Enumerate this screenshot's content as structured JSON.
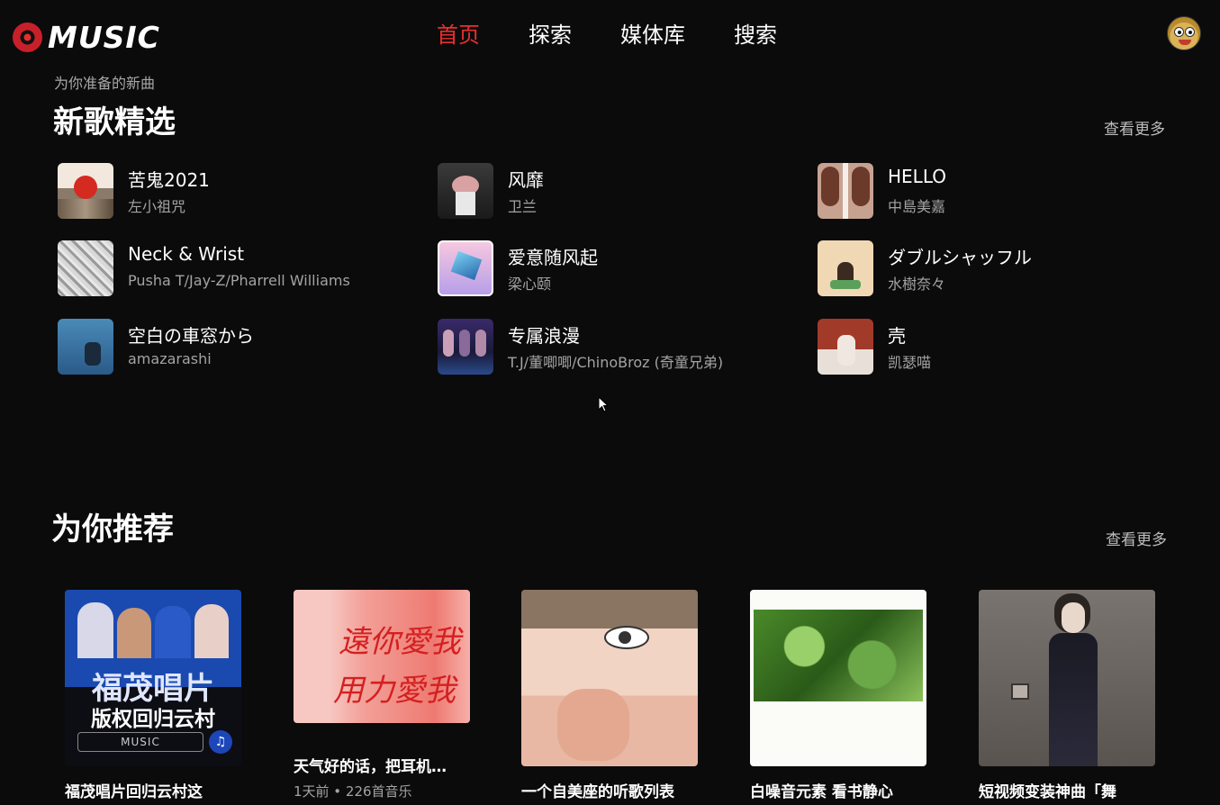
{
  "app": {
    "logo_text": "MUSIC"
  },
  "nav": {
    "items": [
      {
        "label": "首页",
        "active": true
      },
      {
        "label": "探索",
        "active": false
      },
      {
        "label": "媒体库",
        "active": false
      },
      {
        "label": "搜索",
        "active": false
      }
    ]
  },
  "new_songs": {
    "subtitle": "为你准备的新曲",
    "title": "新歌精选",
    "see_more": "查看更多",
    "items": [
      {
        "title": "苦鬼2021",
        "artist": "左小祖咒"
      },
      {
        "title": "风靡",
        "artist": "卫兰"
      },
      {
        "title": "HELLO",
        "artist": "中島美嘉"
      },
      {
        "title": "Neck & Wrist",
        "artist": "Pusha T/Jay-Z/Pharrell Williams"
      },
      {
        "title": "爱意随风起",
        "artist": "梁心颐"
      },
      {
        "title": "ダブルシャッフル",
        "artist": "水樹奈々"
      },
      {
        "title": "空白の車窓から",
        "artist": "amazarashi"
      },
      {
        "title": "专属浪漫",
        "artist": "T.J/董唧唧/ChinoBroz (奇童兄弟)"
      },
      {
        "title": "壳",
        "artist": "凯瑟喵"
      }
    ]
  },
  "recommend": {
    "title": "为你推荐",
    "see_more": "查看更多",
    "cover1_text": {
      "line1": "福茂唱片",
      "line2": "版权回归云村",
      "brand": "MUSIC"
    },
    "cover2_text": {
      "line1": "遠你愛我",
      "line2": "用力愛我"
    },
    "items": [
      {
        "title": "福茂唱片回归云村这",
        "meta": ""
      },
      {
        "title": "天气好的话，把耳机…",
        "meta": "1天前 • 226首音乐"
      },
      {
        "title": "一个自美座的听歌列表",
        "meta": ""
      },
      {
        "title": "白噪音元素 看书静心",
        "meta": ""
      },
      {
        "title": "短视频变装神曲「舞",
        "meta": ""
      }
    ]
  },
  "colors": {
    "accent": "#e8302e",
    "background": "#0b0b0c"
  }
}
